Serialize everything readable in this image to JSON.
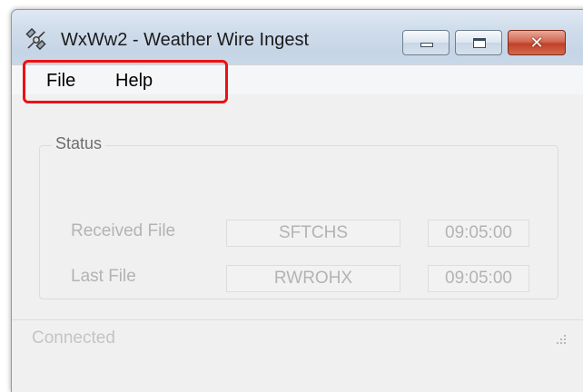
{
  "window": {
    "title": "WxWw2 - Weather Wire Ingest",
    "icon": "satellite-icon",
    "controls": {
      "minimize": "minimize-icon",
      "maximize": "maximize-icon",
      "close_glyph": "✕"
    }
  },
  "menu": {
    "items": [
      {
        "label": "File"
      },
      {
        "label": "Help"
      }
    ],
    "highlight_color": "#ee1111"
  },
  "status_group": {
    "label": "Status",
    "rows": [
      {
        "label": "Received File",
        "file": "SFTCHS",
        "time": "09:05:00"
      },
      {
        "label": "Last File",
        "file": "RWROHX",
        "time": "09:05:00"
      }
    ]
  },
  "statusbar": {
    "text": "Connected"
  }
}
